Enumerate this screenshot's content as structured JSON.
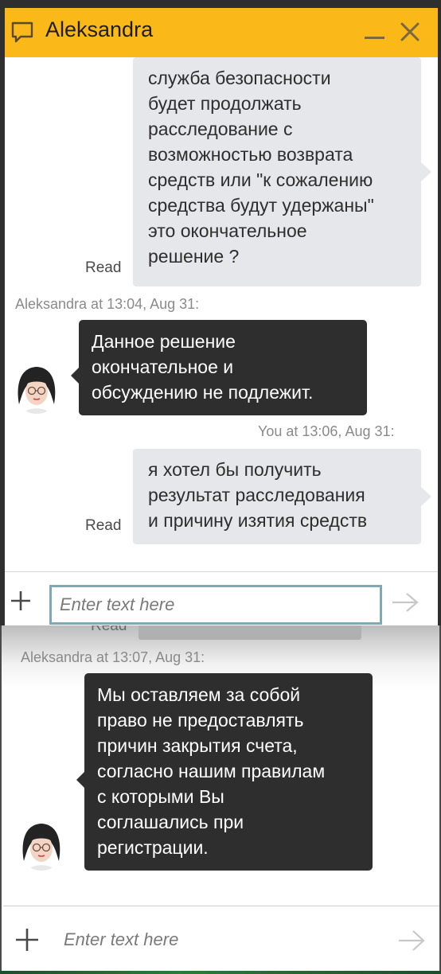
{
  "window": {
    "title": "Aleksandra",
    "icons": {
      "chat": "chat-bubble-icon",
      "minimize": "minimize-icon",
      "close": "close-icon"
    },
    "accent_color": "#fbb919"
  },
  "messages_top": [
    {
      "type": "outgoing",
      "lines": [
        "служба безопасности",
        "будет продолжать",
        "расследование с",
        "возможностью возврата",
        "средств или \"к сожалению",
        "средства будут удержаны\"",
        "это окончательное",
        "решение ?"
      ],
      "status": "Read"
    },
    {
      "type": "incoming",
      "meta": "Aleksandra at 13:04, Aug 31:",
      "lines": [
        "Данное решение",
        "окончательное и",
        "обсуждению не подлежит."
      ]
    },
    {
      "type": "outgoing",
      "meta": "You at 13:06, Aug 31:",
      "lines": [
        "я хотел бы получить",
        "результат расследования",
        "и причину изятия средств"
      ],
      "status": "Read"
    }
  ],
  "input_top": {
    "placeholder": "Enter text here"
  },
  "messages_bottom": [
    {
      "type": "outgoing-partial",
      "status": "Read"
    },
    {
      "type": "incoming",
      "meta": "Aleksandra at 13:07, Aug 31:",
      "lines": [
        "Мы оставляем за собой",
        "право не предоставлять",
        "причин закрытия счета,",
        "согласно нашим правилам",
        "с которыми Вы",
        "соглашались при",
        "регистрации."
      ]
    }
  ],
  "input_bottom": {
    "placeholder": "Enter text here"
  },
  "actions": {
    "attach_icon": "plus-icon",
    "send_icon": "send-arrow-icon"
  }
}
